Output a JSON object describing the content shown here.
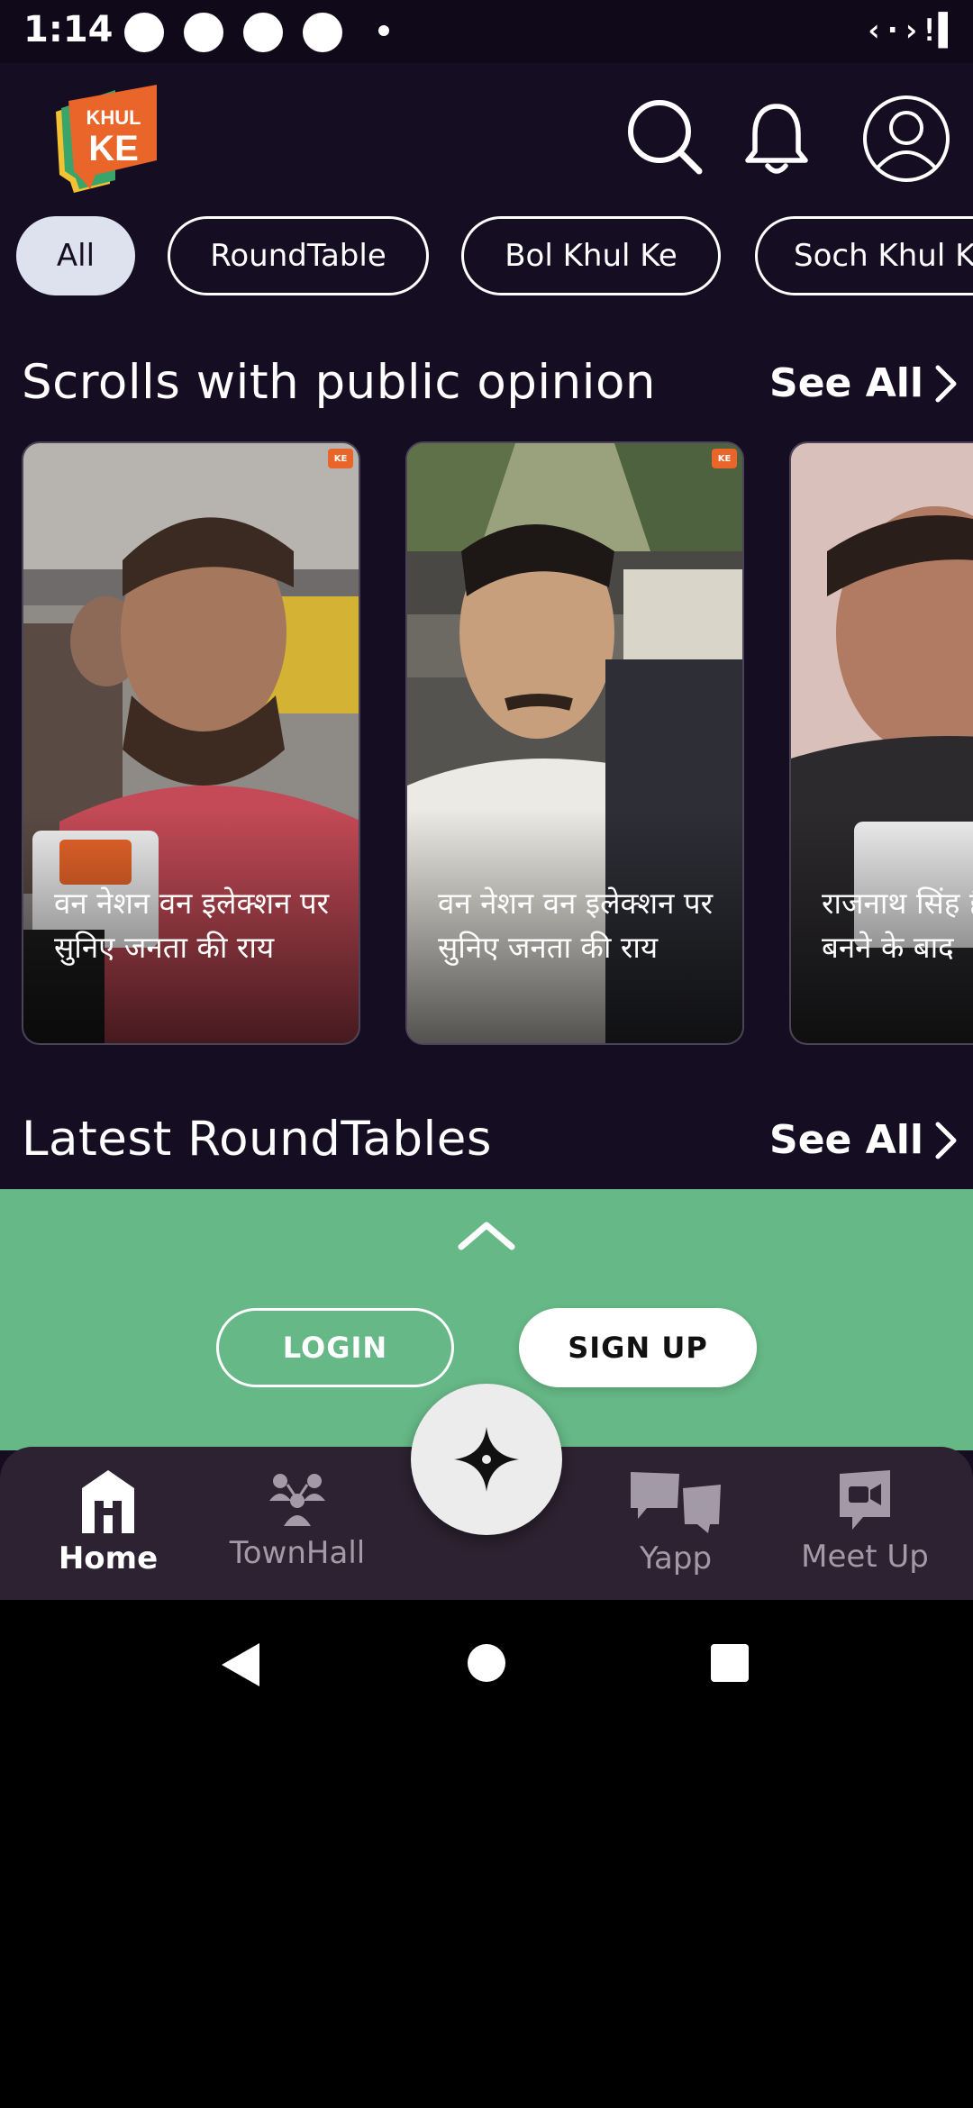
{
  "status_bar": {
    "time": "1:14"
  },
  "header": {
    "logo_text_top": "KHUL",
    "logo_text_bottom": "KE"
  },
  "chips": [
    "All",
    "RoundTable",
    "Bol Khul Ke",
    "Soch Khul Ke"
  ],
  "scrolls_section": {
    "title": "Scrolls with public opinion",
    "see_all": "See All",
    "cards": [
      {
        "caption": "वन नेशन वन इलेक्शन पर सुनिए जनता की राय"
      },
      {
        "caption": "वन नेशन वन इलेक्शन पर सुनिए जनता की राय"
      },
      {
        "caption": "राजनाथ सिंह है कि उनकी बनने के बाद"
      }
    ]
  },
  "roundtables_section": {
    "title": "Latest RoundTables",
    "see_all": "See All"
  },
  "auth": {
    "login": "LOGIN",
    "signup": "SIGN UP"
  },
  "bottom_nav": {
    "home": "Home",
    "townhall": "TownHall",
    "yapp": "Yapp",
    "meetup": "Meet Up"
  },
  "colors": {
    "background": "#150d22",
    "panel_green": "#66b886",
    "nav_bg": "#2c2231",
    "brand_orange": "#e9652a"
  }
}
